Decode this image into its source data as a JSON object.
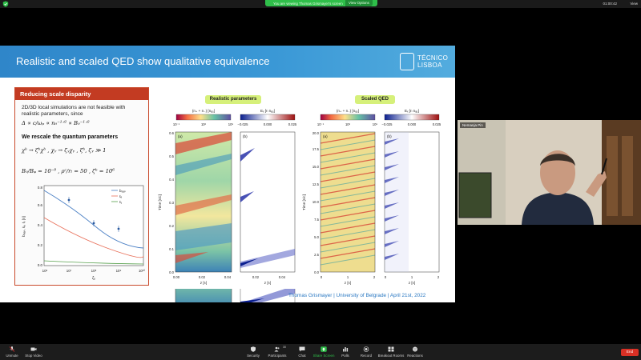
{
  "topbar": {
    "share_message": "You are viewing Thomas Grismayer's screen",
    "view_options": "View Options",
    "clock": "01:00:42",
    "view_label": "View"
  },
  "slide": {
    "title": "Realistic and scaled QED show qualitative equivalence",
    "logo": {
      "line1": "TÉCNICO",
      "line2": "LISBOA"
    },
    "left_box": {
      "heading": "Reducing scale disparity",
      "text1": "2D/3D local simulations are not feasible with",
      "text2": "realistic parameters, since",
      "eq1": "Δ ∝ c/ωₚ ∝ n₀⁻¹ᐟ² ∝ B₀⁻¹ᐟ²",
      "bold1": "We rescale the quantum parameters",
      "eq2": "χᵇ → ζᵇχᵇ ,  χᵧ → ζᵧχᵧ ,  ζᵇ, ζᵧ ≫ 1",
      "eq3": "B₀/Bᵩ = 10⁻⁸ ,  ρᶜ/rₗ = 50 ,  ζᵇ = 10⁶",
      "plot": {
        "ylabel": "b₉ₐₚ, ℓₑ, ℓᵧ [rₗ]",
        "xlabel": "ζᵧ",
        "legend": [
          "b₉ₐₚ",
          "ℓₑ",
          "ℓᵧ"
        ],
        "yticks": [
          "0.0",
          "0.2",
          "0.4",
          "0.6",
          "0.8"
        ],
        "xticks": [
          "10⁶",
          "10⁷",
          "10⁸",
          "10⁹",
          "10¹⁰"
        ]
      }
    },
    "realistic": {
      "label": "Realistic parameters",
      "cb_left_title": "(n₊ + n₋) [nᵩ₁]",
      "cb_left_ticks": [
        "10⁻¹",
        "10²",
        "10⁵"
      ],
      "cb_right_title": "Eₓ [rₗ nᵩ₁]",
      "cb_right_ticks": [
        "−0.025",
        "0.000",
        "0.025"
      ],
      "panel_a": "(a)",
      "panel_b": "(b)",
      "yticks": [
        "0.0",
        "0.1",
        "0.2",
        "0.3",
        "0.4",
        "0.5",
        "0.6"
      ],
      "xticks_a": [
        "0.00",
        "0.02",
        "0.04"
      ],
      "xticks_b": [
        "0.02",
        "0.04"
      ],
      "ylabel": "Time [rₗ/c]",
      "xlabel": "z [rₗ]"
    },
    "scaled": {
      "label": "Scaled QED",
      "cb_left_title": "(n₊ + n₋) [nᵩ₁]",
      "cb_left_ticks": [
        "10⁻¹",
        "10²",
        "10⁵"
      ],
      "cb_right_title": "Eₓ [rₗ nᵩ₁]",
      "cb_right_ticks": [
        "−0.025",
        "0.000",
        "0.025"
      ],
      "panel_a": "(a)",
      "panel_b": "(b)",
      "yticks": [
        "0.0",
        "2.5",
        "5.0",
        "7.5",
        "10.0",
        "12.5",
        "15.0",
        "17.5",
        "20.0"
      ],
      "xticks_a": [
        "0",
        "1",
        "2"
      ],
      "xticks_b": [
        "0",
        "1",
        "2"
      ],
      "ylabel": "Time [rₗ/c]",
      "xlabel": "z [rₗ]"
    },
    "footer": "Thomas Grismayer | University of Belgrade | April 21st, 2022"
  },
  "video": {
    "name": "Nemanja Pin"
  },
  "toolbar": {
    "items": [
      "Unmute",
      "Stop Video",
      "Security",
      "Participants",
      "Chat",
      "Share Screen",
      "Polls",
      "Record",
      "Breakout Rooms",
      "Reactions"
    ],
    "participants_count": "30",
    "end": "End"
  },
  "colors": {
    "accent": "#2f86c9",
    "box_red": "#c33b22",
    "end_red": "#d93025",
    "share_green": "#2fbf4a"
  }
}
